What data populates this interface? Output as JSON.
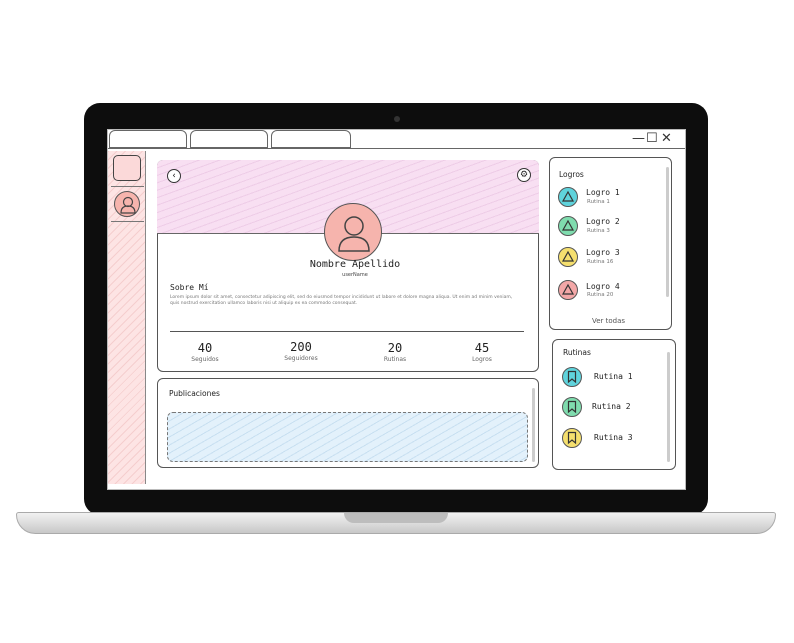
{
  "window": {
    "controls": [
      "—",
      "☐",
      "✕"
    ]
  },
  "profile": {
    "name": "Nombre Apellido",
    "username": "userName",
    "about_title": "Sobre Mí",
    "about_text": "Lorem ipsum dolor sit amet, consectetur adipiscing elit, sed do eiusmod tempor incididunt ut labore et dolore magna aliqua. Ut enim ad minim veniam, quis nostrud exercitation ullamco laboris nisi ut aliquip ex ea commodo consequat.",
    "stats": [
      {
        "value": "40",
        "label": "Seguidos"
      },
      {
        "value": "200",
        "label": "Seguidores"
      },
      {
        "value": "20",
        "label": "Rutinas"
      },
      {
        "value": "45",
        "label": "Logros"
      }
    ]
  },
  "publicaciones": {
    "title": "Publicaciones"
  },
  "logros": {
    "title": "Logros",
    "view_all": "Ver todas",
    "items": [
      {
        "title": "Logro 1",
        "sub": "Rutina 1",
        "color": "#5fd3dc",
        "icon": "triangle-icon"
      },
      {
        "title": "Logro 2",
        "sub": "Rutina 3",
        "color": "#7fdcae",
        "icon": "triangle-icon"
      },
      {
        "title": "Logro 3",
        "sub": "Rutina 16",
        "color": "#f5df6e",
        "icon": "triangle-icon"
      },
      {
        "title": "Logro 4",
        "sub": "Rutina 20",
        "color": "#f3a7a7",
        "icon": "triangle-icon"
      }
    ]
  },
  "rutinas": {
    "title": "Rutinas",
    "items": [
      {
        "title": "Rutina 1",
        "color": "#5fd3dc",
        "icon": "bookmark-icon"
      },
      {
        "title": "Rutina 2",
        "color": "#7fdcae",
        "icon": "bookmark-icon"
      },
      {
        "title": "Rutina 3",
        "color": "#f5df6e",
        "icon": "bookmark-icon"
      }
    ]
  },
  "colors": {
    "banner": "#f8dff2",
    "avatar": "#f6b4ad",
    "sidebar": "#fde4e4",
    "posts_box": "#e3f1fb"
  }
}
